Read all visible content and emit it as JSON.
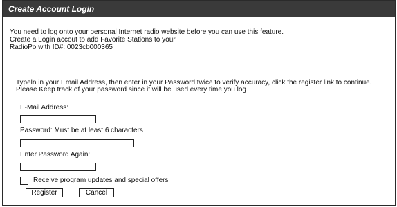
{
  "dialog": {
    "title": "Create Account Login",
    "intro_lines": [
      "You need to log onto your personal Internet radio website before you can use this feature.",
      "Create a Login accout to add Favorite Stations to your",
      "RadioPo with ID#: 0023cb000365"
    ],
    "instructions_lines": [
      "Typeln in your Email Address, then enter in your Password twice to verify accuracy, click the register link to continue.",
      "Please Keep track of your password since it will be used every time you log"
    ]
  },
  "form": {
    "email_label": "E-Mail Address:",
    "email_value": "",
    "password_label": "Password: Must be at least 6 characters",
    "password_value": "",
    "password_again_label": "Enter Password Again:",
    "password_again_value": "",
    "offers_label": "Receive program updates and special  offers",
    "offers_checked": false
  },
  "buttons": {
    "register_label": "Register",
    "cancel_label": "Cancel"
  }
}
